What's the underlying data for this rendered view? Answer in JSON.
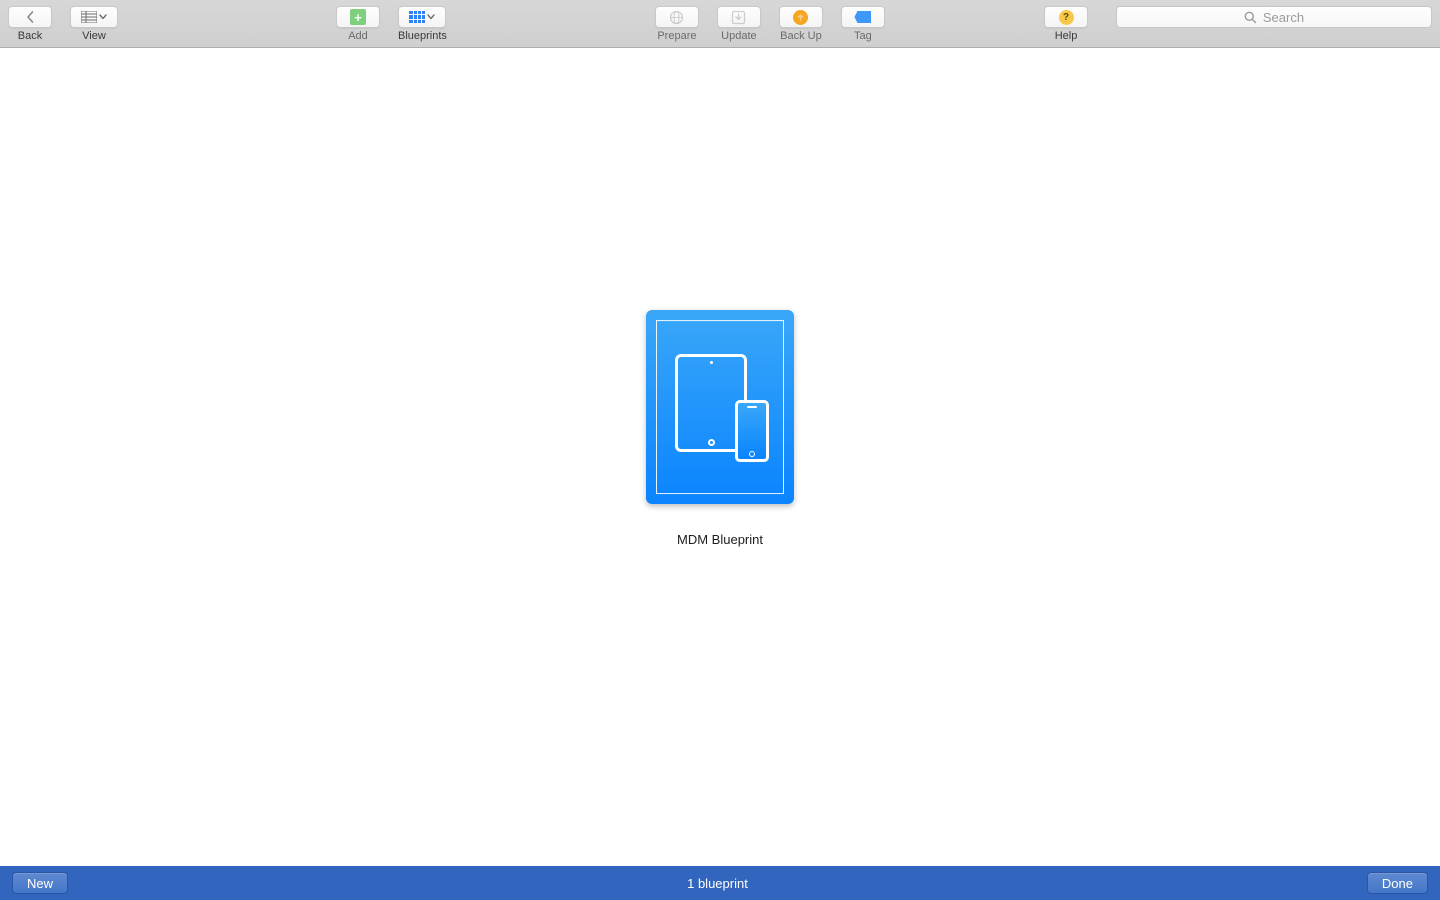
{
  "toolbar": {
    "back_label": "Back",
    "view_label": "View",
    "add_label": "Add",
    "blueprints_label": "Blueprints",
    "prepare_label": "Prepare",
    "update_label": "Update",
    "backup_label": "Back Up",
    "tag_label": "Tag",
    "help_label": "Help",
    "search_placeholder": "Search"
  },
  "content": {
    "blueprints": [
      {
        "name": "MDM Blueprint"
      }
    ]
  },
  "bottombar": {
    "new_label": "New",
    "status_text": "1 blueprint",
    "done_label": "Done"
  },
  "colors": {
    "accent": "#0a84ff",
    "bottombar": "#3265bd"
  }
}
